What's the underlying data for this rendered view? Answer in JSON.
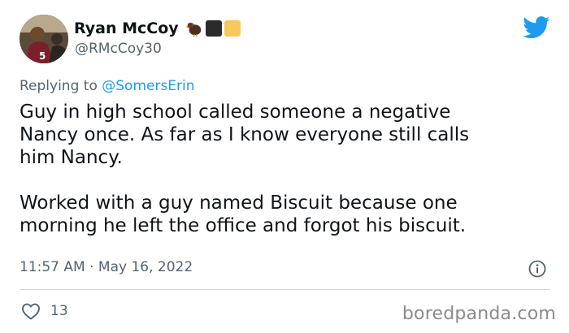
{
  "author": {
    "display_name": "Ryan McCoy",
    "handle": "@RMcCoy30",
    "name_emojis": [
      "turkey-emoji",
      "black-square-emoji",
      "yellow-square-emoji"
    ]
  },
  "reply": {
    "prefix": "Replying to ",
    "mention": "@SomersErin"
  },
  "tweet": {
    "text": "Guy in high school called someone a negative\nNancy once. As far as I know everyone still calls\nhim Nancy.\n\nWorked with a guy named Biscuit because one\nmorning he left the office and forgot his biscuit.",
    "timestamp": "11:57 AM · May 16, 2022",
    "like_count": "13"
  },
  "watermark": "boredpanda.com",
  "colors": {
    "twitter_blue": "#1d9bf0",
    "secondary_text": "#536471",
    "divider": "#cfd9de",
    "emoji_black": "#2b2b2b",
    "emoji_yellow": "#f7c95c"
  },
  "icons": {
    "platform": "twitter-bird-icon",
    "info": "info-icon",
    "like": "heart-icon"
  }
}
